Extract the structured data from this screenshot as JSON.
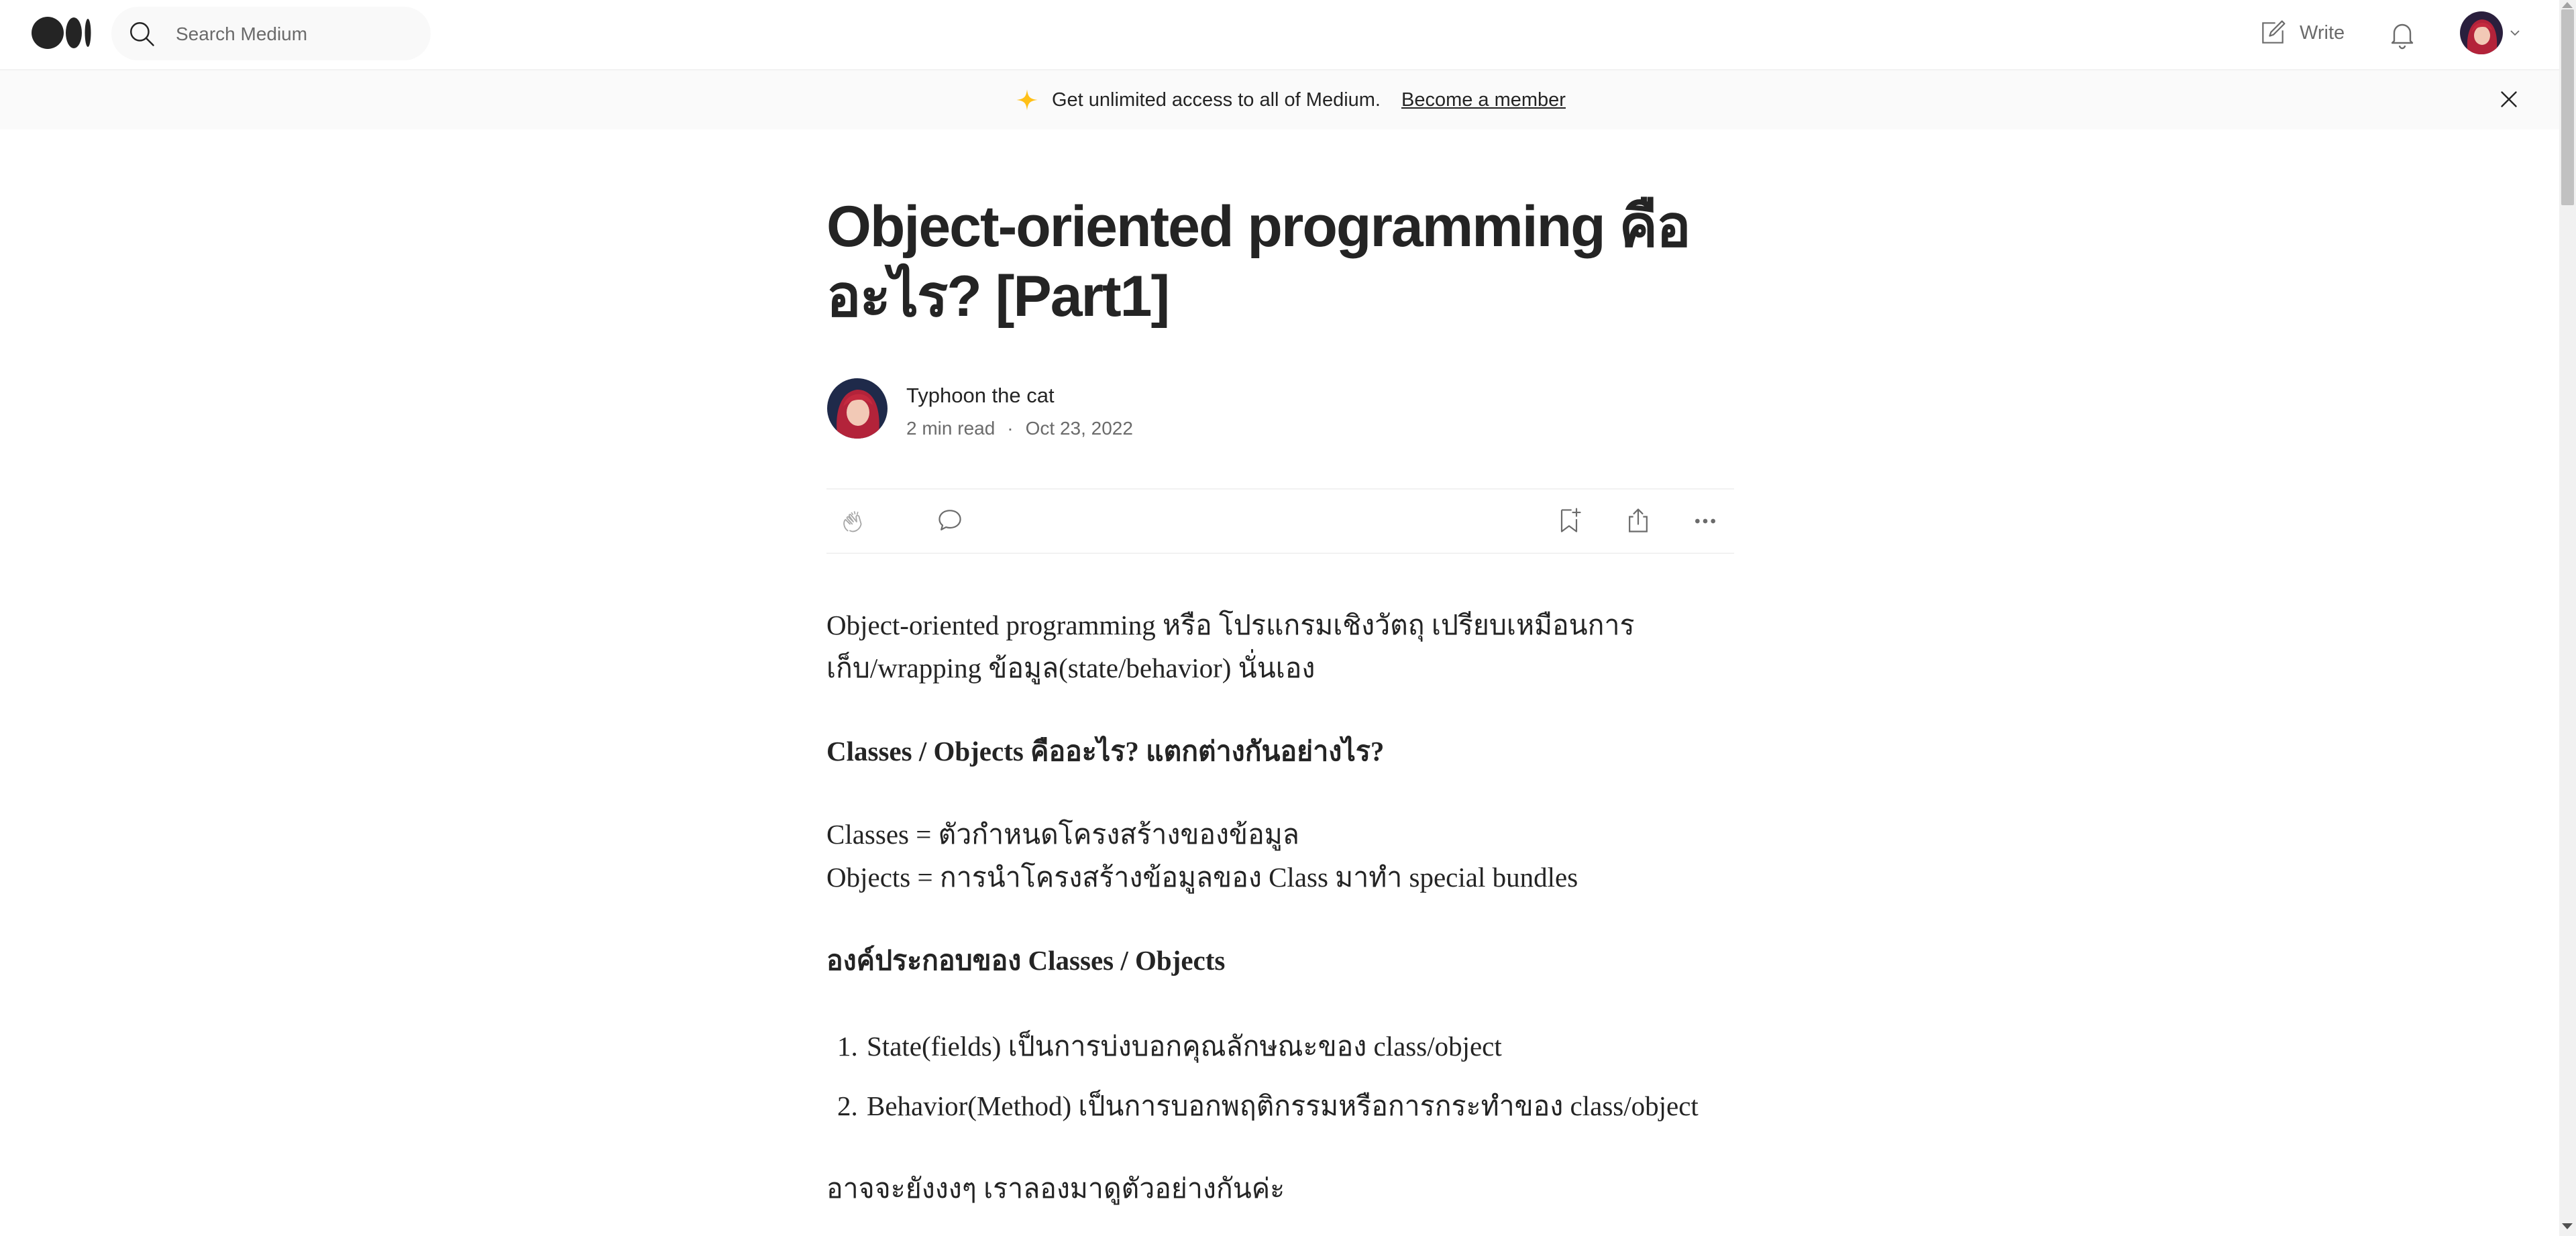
{
  "colors": {
    "text": "#242424",
    "muted": "#6b6b6b",
    "banner_bg": "#fafafa",
    "star": "#ffc017"
  },
  "nav": {
    "search_placeholder": "Search Medium",
    "write_label": "Write",
    "icons": [
      "medium-logo",
      "search-icon",
      "write-icon",
      "bell-icon",
      "avatar",
      "chevron-down-icon"
    ]
  },
  "banner": {
    "text": "Get unlimited access to all of Medium.",
    "link": "Become a member",
    "icons": [
      "star-icon",
      "close-icon"
    ]
  },
  "article": {
    "title_line1": "Object-oriented programming คือ",
    "title_line2": "อะไร? [Part1]",
    "author": "Typhoon the cat",
    "read_time": "2 min read",
    "separator": "·",
    "date": "Oct 23, 2022",
    "action_icons": [
      "clap-icon",
      "comment-icon",
      "bookmark-add-icon",
      "share-icon",
      "more-icon"
    ],
    "paragraphs": {
      "intro_line1": "Object-oriented programming หรือ โปรแกรมเชิงวัตถุ เปรียบเหมือนการ",
      "intro_line2": "เก็บ/wrapping ข้อมูล(state/behavior) นั่นเอง",
      "heading1": "Classes / Objects คืออะไร? แตกต่างกันอย่างไร?",
      "classes_def": "Classes = ตัวกำหนดโครงสร้างของข้อมูล",
      "objects_def": "Objects = การนำโครงสร้างข้อมูลของ Class มาทำ special bundles",
      "heading2": "องค์ประกอบของ Classes / Objects",
      "list": [
        {
          "num": "1.",
          "text": "State(fields) เป็นการบ่งบอกคุณลักษณะของ class/object"
        },
        {
          "num": "2.",
          "text": "Behavior(Method) เป็นการบอกพฤติกรรมหรือการกระทำของ class/object"
        }
      ],
      "closing": "อาจจะยังงงๆ เราลองมาดูตัวอย่างกันค่ะ"
    }
  }
}
